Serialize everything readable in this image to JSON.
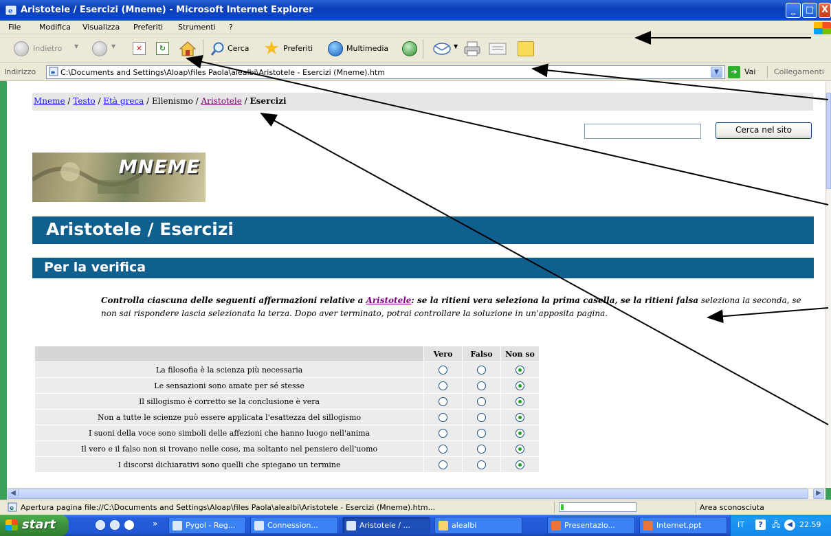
{
  "window": {
    "title": "Aristotele / Esercizi (Mneme) - Microsoft Internet Explorer",
    "controls": [
      "_",
      "□",
      "X"
    ]
  },
  "menu": [
    "File",
    "Modifica",
    "Visualizza",
    "Preferiti",
    "Strumenti",
    "?"
  ],
  "toolbar": {
    "back": "Indietro",
    "search": "Cerca",
    "favorites": "Preferiti",
    "media": "Multimedia"
  },
  "address": {
    "label": "Indirizzo",
    "value": "C:\\Documents and Settings\\Aloap\\files Paola\\alealbi\\Aristotele - Esercizi (Mneme).htm",
    "go": "Vai",
    "links": "Collegamenti"
  },
  "page": {
    "breadcrumb": {
      "mneme": "Mneme",
      "testo": "Testo",
      "eta": "Età greca",
      "ellenismo": "Ellenismo",
      "aristotele": "Aristotele",
      "current": "Esercizi",
      "sep": " / "
    },
    "search_value": "",
    "search_button": "Cerca nel sito",
    "logo": "MNEME",
    "heading": "Aristotele / Esercizi",
    "subheading": "Per la verifica",
    "intro": {
      "bold_before": "Controlla ciascuna delle seguenti affermazioni relative a ",
      "link": "Aristotele",
      "bold_after": ": se la ritieni vera seleziona la prima casella, se la ritieni falsa",
      "rest": " seleziona la seconda, se non sai rispondere lascia selezionata la terza. Dopo aver terminato, potrai controllare la soluzione in un'apposita pagina."
    },
    "quiz": {
      "columns": [
        "Vero",
        "Falso",
        "Non so"
      ],
      "rows": [
        {
          "statement": "La filosofia è la scienza più necessaria",
          "selected": 2
        },
        {
          "statement": "Le sensazioni sono amate per sé stesse",
          "selected": 2
        },
        {
          "statement": "Il sillogismo è corretto se la conclusione è vera",
          "selected": 2
        },
        {
          "statement": "Non a tutte le scienze può essere applicata l'esattezza del sillogismo",
          "selected": 2
        },
        {
          "statement": "I suoni della voce sono simboli delle affezioni che hanno luogo nell'anima",
          "selected": 2
        },
        {
          "statement": "Il vero e il falso non si trovano nelle cose, ma soltanto nel pensiero dell'uomo",
          "selected": 2
        },
        {
          "statement": "I discorsi dichiarativi sono quelli che spiegano un termine",
          "selected": 2
        }
      ]
    }
  },
  "status": {
    "text": "Apertura pagina file://C:\\Documents and Settings\\Aloap\\files Paola\\alealbi\\Aristotele - Esercizi (Mneme).htm...",
    "progress": 0.04,
    "zone": "Area sconosciuta"
  },
  "taskbar": {
    "start": "start",
    "tasks": [
      "Pygol - Reg...",
      "Connession...",
      "Aristotele / ...",
      "alealbi",
      "Presentazio...",
      "Internet.ppt"
    ],
    "lang": "IT",
    "clock": "22.59"
  },
  "colors": {
    "heading_bar": "#0f5f8f",
    "link": "#1a1aff",
    "visited": "#800080",
    "selected_radio": "#21a121"
  }
}
